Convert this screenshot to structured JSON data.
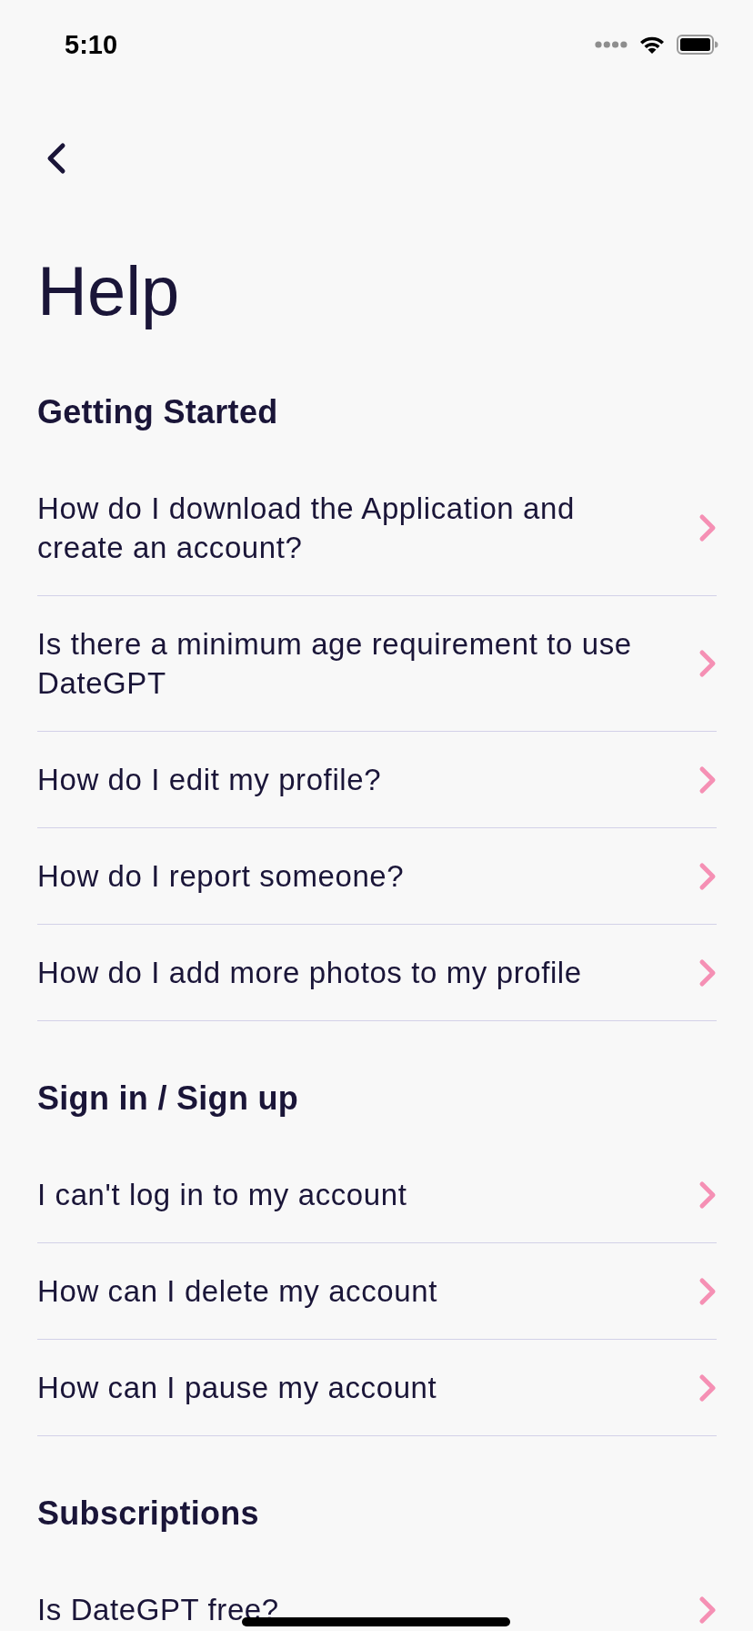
{
  "status_bar": {
    "time": "5:10"
  },
  "title": "Help",
  "sections": [
    {
      "title": "Getting Started",
      "items": [
        {
          "label": "How do I download the Application and create an account?"
        },
        {
          "label": "Is there a minimum age requirement to use DateGPT"
        },
        {
          "label": "How do I edit my profile?"
        },
        {
          "label": "How do I report someone?"
        },
        {
          "label": "How do I add more photos to my profile"
        }
      ]
    },
    {
      "title": "Sign in / Sign up",
      "items": [
        {
          "label": "I can't log in to my account"
        },
        {
          "label": "How can I delete my account"
        },
        {
          "label": "How can I pause my account"
        }
      ]
    },
    {
      "title": "Subscriptions",
      "items": [
        {
          "label": "Is DateGPT free?"
        }
      ]
    }
  ]
}
